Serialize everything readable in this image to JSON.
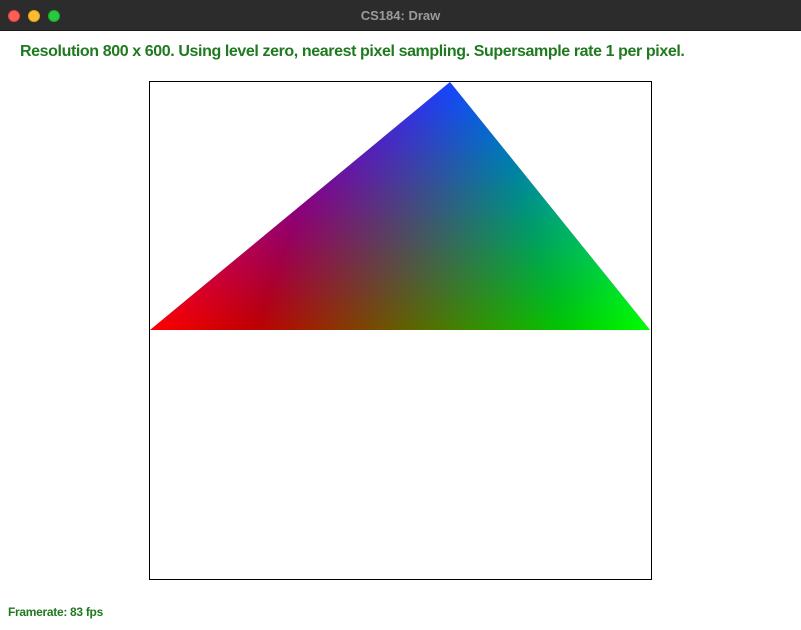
{
  "window": {
    "title": "CS184: Draw"
  },
  "status": {
    "text": "Resolution 800 x 600. Using level zero, nearest pixel sampling. Supersample rate 1 per pixel."
  },
  "footer": {
    "framerate_text": "Framerate: 83 fps"
  },
  "triangle": {
    "vertex_colors": [
      "#ff0000",
      "#0000ff",
      "#00ff00"
    ]
  },
  "colors": {
    "status_text": "#1f7a1f",
    "titlebar": "#2c2c2c",
    "title_text": "#9b9b9b"
  }
}
